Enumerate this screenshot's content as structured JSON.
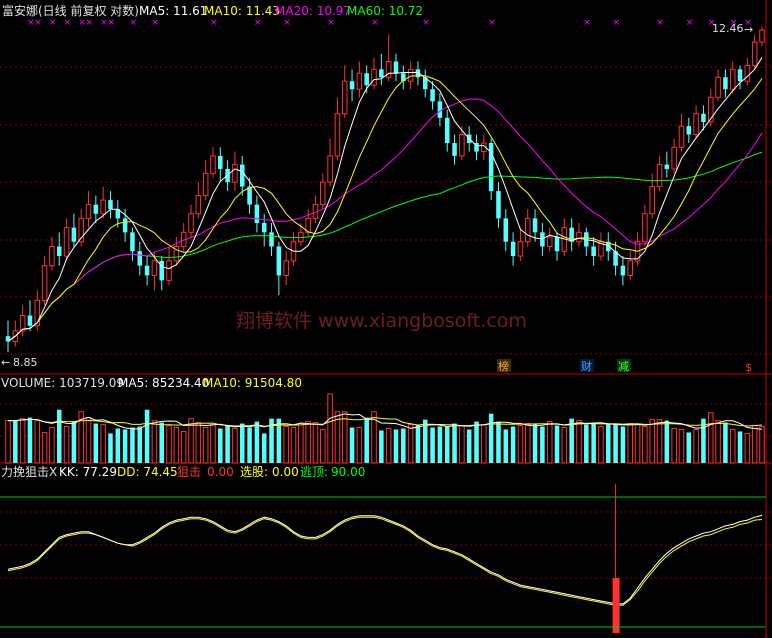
{
  "colors": {
    "background": "#000000",
    "up": "#ff3232",
    "down": "#54ffff",
    "grid": "#8b0000",
    "white": "#ffffff",
    "yellow": "#ffff00",
    "magenta": "#ff00ff",
    "green": "#00ff00",
    "label": "#e0e0e0",
    "watermark": "#6e1e1e"
  },
  "header": {
    "title": "富安娜(日线 前复权 对数)",
    "ma5": "MA5: 11.61",
    "ma10": "MA10: 11.43",
    "ma20": "MA20: 10.97",
    "ma60": "MA60: 10.72"
  },
  "price_panel": {
    "max_label": "12.46",
    "min_label": "8.85",
    "watermark": "翔博软件 www.xiangbosoft.com",
    "event_tags": [
      "榜",
      "财",
      "减",
      "$"
    ]
  },
  "volume_panel": {
    "title": "VOLUME: 103719.09",
    "ma5": "MA5: 85234.40",
    "ma10": "MA10: 91504.80"
  },
  "indicator_panel": {
    "title": "力挽狙击X",
    "kk": "KK: 77.29",
    "dd": "DD: 74.45",
    "snipe_label": "狙击",
    "snipe_value": "0.00",
    "pick_label": "选股:",
    "pick_value": "0.00",
    "escape_label": "逃顶:",
    "escape_value": "90.00"
  },
  "chart_data": [
    {
      "type": "candlestick",
      "title": "富安娜(日线 前复权 对数)",
      "scale": "log",
      "y_range_labels": [
        8.85,
        12.46
      ],
      "candles": [
        [
          9.0,
          8.95,
          9.15,
          8.85
        ],
        [
          8.95,
          9.05,
          9.15,
          8.9
        ],
        [
          9.05,
          9.2,
          9.3,
          9.0
        ],
        [
          9.2,
          9.1,
          9.35,
          9.05
        ],
        [
          9.1,
          9.35,
          9.45,
          9.05
        ],
        [
          9.35,
          9.7,
          9.8,
          9.3
        ],
        [
          9.7,
          9.9,
          10.0,
          9.65
        ],
        [
          9.9,
          9.8,
          10.05,
          9.7
        ],
        [
          9.8,
          10.1,
          10.2,
          9.75
        ],
        [
          10.1,
          9.95,
          10.25,
          9.9
        ],
        [
          9.95,
          10.2,
          10.3,
          9.9
        ],
        [
          10.2,
          10.35,
          10.5,
          10.1
        ],
        [
          10.35,
          10.25,
          10.45,
          10.15
        ],
        [
          10.25,
          10.4,
          10.55,
          10.2
        ],
        [
          10.4,
          10.3,
          10.5,
          10.2
        ],
        [
          10.3,
          10.2,
          10.4,
          10.1
        ],
        [
          10.2,
          10.05,
          10.3,
          9.95
        ],
        [
          10.05,
          9.85,
          10.1,
          9.75
        ],
        [
          9.85,
          9.7,
          9.95,
          9.6
        ],
        [
          9.7,
          9.6,
          9.8,
          9.5
        ],
        [
          9.6,
          9.75,
          9.85,
          9.45
        ],
        [
          9.75,
          9.55,
          9.8,
          9.45
        ],
        [
          9.55,
          9.75,
          9.9,
          9.5
        ],
        [
          9.75,
          9.9,
          10.0,
          9.7
        ],
        [
          9.9,
          10.05,
          10.15,
          9.85
        ],
        [
          10.05,
          10.25,
          10.35,
          10.0
        ],
        [
          10.25,
          10.45,
          10.6,
          10.2
        ],
        [
          10.45,
          10.7,
          10.85,
          10.4
        ],
        [
          10.7,
          10.9,
          11.0,
          10.65
        ],
        [
          10.9,
          10.75,
          11.0,
          10.6
        ],
        [
          10.75,
          10.6,
          10.85,
          10.5
        ],
        [
          10.6,
          10.8,
          10.95,
          10.5
        ],
        [
          10.8,
          10.55,
          10.9,
          10.45
        ],
        [
          10.55,
          10.35,
          10.65,
          10.25
        ],
        [
          10.35,
          10.15,
          10.45,
          10.05
        ],
        [
          10.15,
          10.05,
          10.25,
          9.9
        ],
        [
          10.05,
          9.9,
          10.15,
          9.8
        ],
        [
          9.9,
          9.6,
          9.95,
          9.4
        ],
        [
          9.6,
          9.75,
          9.85,
          9.5
        ],
        [
          9.75,
          9.95,
          10.05,
          9.7
        ],
        [
          9.95,
          10.05,
          10.15,
          9.9
        ],
        [
          10.05,
          10.2,
          10.3,
          10.0
        ],
        [
          10.2,
          10.35,
          10.45,
          10.15
        ],
        [
          10.35,
          10.6,
          10.7,
          10.3
        ],
        [
          10.6,
          10.9,
          11.1,
          10.55
        ],
        [
          10.9,
          11.4,
          11.6,
          10.85
        ],
        [
          11.4,
          11.8,
          12.0,
          11.35
        ],
        [
          11.8,
          11.7,
          11.95,
          11.55
        ],
        [
          11.7,
          11.9,
          12.05,
          11.6
        ],
        [
          11.9,
          11.75,
          12.0,
          11.65
        ],
        [
          11.75,
          11.95,
          12.1,
          11.7
        ],
        [
          11.95,
          11.85,
          12.15,
          11.75
        ],
        [
          11.85,
          12.05,
          12.4,
          11.8
        ],
        [
          12.05,
          11.9,
          12.15,
          11.8
        ],
        [
          11.9,
          11.8,
          12.0,
          11.7
        ],
        [
          11.8,
          11.95,
          12.05,
          11.7
        ],
        [
          11.95,
          11.85,
          12.05,
          11.75
        ],
        [
          11.85,
          11.7,
          11.95,
          11.6
        ],
        [
          11.7,
          11.55,
          11.8,
          11.45
        ],
        [
          11.55,
          11.35,
          11.65,
          11.25
        ],
        [
          11.35,
          11.05,
          11.45,
          10.95
        ],
        [
          11.05,
          10.9,
          11.15,
          10.8
        ],
        [
          10.9,
          11.15,
          11.25,
          10.85
        ],
        [
          11.15,
          11.05,
          11.25,
          10.95
        ],
        [
          11.05,
          10.95,
          11.15,
          10.85
        ],
        [
          10.95,
          11.05,
          11.15,
          10.85
        ],
        [
          11.05,
          10.5,
          11.1,
          10.4
        ],
        [
          10.5,
          10.2,
          10.6,
          10.1
        ],
        [
          10.2,
          9.95,
          10.3,
          9.85
        ],
        [
          9.95,
          9.8,
          10.05,
          9.7
        ],
        [
          9.8,
          9.95,
          10.1,
          9.75
        ],
        [
          9.95,
          10.2,
          10.3,
          9.9
        ],
        [
          10.2,
          10.05,
          10.3,
          9.95
        ],
        [
          10.05,
          9.9,
          10.15,
          9.8
        ],
        [
          9.9,
          10.0,
          10.1,
          9.85
        ],
        [
          10.0,
          9.85,
          10.05,
          9.75
        ],
        [
          9.85,
          10.1,
          10.2,
          9.8
        ],
        [
          10.1,
          9.95,
          10.2,
          9.85
        ],
        [
          9.95,
          10.05,
          10.15,
          9.9
        ],
        [
          10.05,
          9.9,
          10.1,
          9.8
        ],
        [
          9.9,
          9.8,
          10.0,
          9.7
        ],
        [
          9.8,
          9.95,
          10.05,
          9.75
        ],
        [
          9.95,
          9.85,
          10.05,
          9.75
        ],
        [
          9.85,
          9.7,
          9.95,
          9.6
        ],
        [
          9.7,
          9.6,
          9.8,
          9.5
        ],
        [
          9.6,
          9.75,
          9.85,
          9.55
        ],
        [
          9.75,
          9.95,
          10.05,
          9.7
        ],
        [
          9.95,
          10.25,
          10.35,
          9.9
        ],
        [
          10.25,
          10.55,
          10.7,
          10.2
        ],
        [
          10.55,
          10.8,
          10.9,
          10.5
        ],
        [
          10.8,
          10.75,
          10.95,
          10.65
        ],
        [
          10.75,
          11.0,
          11.1,
          10.7
        ],
        [
          11.0,
          11.25,
          11.4,
          10.95
        ],
        [
          11.25,
          11.15,
          11.35,
          11.05
        ],
        [
          11.15,
          11.4,
          11.5,
          11.1
        ],
        [
          11.4,
          11.3,
          11.5,
          11.2
        ],
        [
          11.3,
          11.6,
          11.7,
          11.25
        ],
        [
          11.6,
          11.85,
          11.95,
          11.55
        ],
        [
          11.85,
          11.7,
          11.95,
          11.6
        ],
        [
          11.7,
          11.95,
          12.05,
          11.65
        ],
        [
          11.95,
          11.8,
          12.0,
          11.7
        ],
        [
          11.8,
          12.0,
          12.1,
          11.75
        ],
        [
          12.0,
          12.3,
          12.4,
          11.95
        ],
        [
          12.3,
          12.46,
          12.5,
          12.25
        ]
      ]
    },
    {
      "type": "bar",
      "title": "VOLUME",
      "values": [
        43,
        43,
        45,
        46,
        43,
        31,
        36,
        54,
        37,
        42,
        52,
        46,
        40,
        39,
        30,
        35,
        34,
        36,
        37,
        54,
        43,
        41,
        38,
        36,
        32,
        45,
        41,
        36,
        39,
        35,
        38,
        35,
        40,
        36,
        42,
        30,
        45,
        45,
        37,
        36,
        40,
        42,
        41,
        34,
        70,
        52,
        52,
        36,
        36,
        46,
        52,
        33,
        35,
        34,
        35,
        39,
        39,
        44,
        36,
        37,
        37,
        40,
        38,
        34,
        42,
        39,
        50,
        42,
        34,
        37,
        38,
        40,
        40,
        37,
        42,
        38,
        36,
        45,
        43,
        39,
        40,
        37,
        40,
        39,
        37,
        40,
        39,
        37,
        44,
        44,
        43,
        35,
        34,
        31,
        34,
        45,
        51,
        43,
        41,
        34,
        32,
        30,
        38,
        37
      ],
      "up": [
        true,
        false,
        true,
        false,
        true,
        true,
        true,
        false,
        true,
        false,
        true,
        true,
        false,
        true,
        false,
        false,
        false,
        false,
        false,
        false,
        true,
        false,
        true,
        true,
        true,
        true,
        true,
        true,
        true,
        false,
        false,
        true,
        false,
        false,
        false,
        false,
        false,
        false,
        true,
        true,
        true,
        true,
        true,
        true,
        true,
        true,
        true,
        false,
        true,
        false,
        true,
        false,
        true,
        false,
        false,
        true,
        false,
        false,
        false,
        false,
        false,
        false,
        true,
        false,
        false,
        true,
        false,
        false,
        false,
        false,
        true,
        true,
        false,
        false,
        true,
        false,
        true,
        false,
        true,
        false,
        false,
        true,
        false,
        false,
        false,
        true,
        true,
        true,
        true,
        true,
        false,
        true,
        true,
        false,
        true,
        false,
        true,
        true,
        false,
        true,
        false,
        true,
        true,
        true
      ]
    },
    {
      "type": "line",
      "title": "力挽狙击X",
      "series": [
        {
          "name": "KK",
          "values": [
            40,
            41,
            42,
            44,
            47,
            52,
            57,
            62,
            64,
            65,
            66,
            66,
            64,
            62,
            60,
            58,
            57,
            57,
            59,
            62,
            65,
            69,
            72,
            74,
            75,
            76,
            76,
            75,
            73,
            70,
            67,
            66,
            68,
            71,
            74,
            76,
            75,
            73,
            70,
            66,
            63,
            62,
            62,
            64,
            67,
            71,
            74,
            76,
            77,
            77,
            77,
            76,
            74,
            72,
            70,
            67,
            63,
            60,
            57,
            55,
            54,
            52,
            50,
            47,
            44,
            41,
            38,
            36,
            33,
            31,
            29,
            28,
            27,
            26,
            25,
            24,
            23,
            22,
            21,
            20,
            19,
            18,
            17,
            16,
            16,
            20,
            27,
            34,
            40,
            46,
            51,
            55,
            58,
            61,
            63,
            65,
            66,
            68,
            70,
            71,
            73,
            74,
            76,
            77.29
          ]
        },
        {
          "name": "DD",
          "values": [
            39,
            40,
            41,
            43,
            46,
            51,
            56,
            61,
            63,
            64,
            65,
            65,
            64,
            62,
            60,
            58,
            57,
            56,
            58,
            61,
            64,
            68,
            71,
            73,
            74,
            75,
            75,
            74,
            72,
            69,
            66,
            65,
            67,
            70,
            73,
            75,
            74,
            72,
            69,
            65,
            62,
            61,
            61,
            63,
            66,
            70,
            73,
            75,
            76,
            76,
            76,
            75,
            73,
            71,
            69,
            66,
            62,
            59,
            56,
            54,
            53,
            51,
            49,
            46,
            43,
            40,
            37,
            35,
            32,
            30,
            28,
            27,
            26,
            25,
            24,
            23,
            22,
            21,
            20,
            19,
            18,
            17,
            16,
            15,
            15,
            19,
            25,
            32,
            38,
            44,
            49,
            53,
            56,
            59,
            61,
            63,
            64,
            66,
            68,
            69,
            71,
            72,
            74,
            74.45
          ]
        }
      ]
    }
  ]
}
